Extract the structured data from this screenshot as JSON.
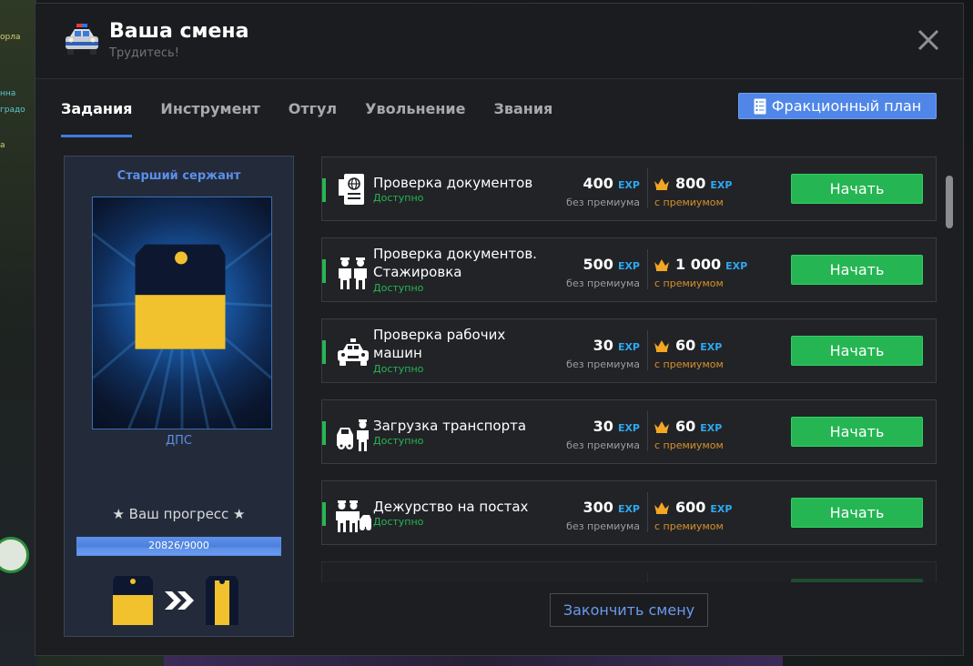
{
  "background": {
    "chat_lines": [
      "орла",
      "нна",
      "градо",
      "а"
    ]
  },
  "window": {
    "title": "Ваша смена",
    "subtitle": "Трудитесь!",
    "icon": "police-car-icon",
    "close_icon": "close-icon"
  },
  "tabs": [
    {
      "label": "Задания",
      "active": true
    },
    {
      "label": "Инструмент",
      "active": false
    },
    {
      "label": "Отгул",
      "active": false
    },
    {
      "label": "Увольнение",
      "active": false
    },
    {
      "label": "Звания",
      "active": false
    }
  ],
  "plan_button": {
    "label": "Фракционный план",
    "icon": "checklist-icon"
  },
  "rank": {
    "name": "Старший сержант",
    "department": "ДПС",
    "progress_label": "★ Ваш прогресс ★",
    "progress_text": "20826/9000",
    "progress_fraction": 1.0
  },
  "colors": {
    "accent_blue": "#4f86e8",
    "start_green": "#25b653",
    "exp_blue": "#2fa8f0",
    "premium_orange": "#d6912a",
    "rank_gold": "#f2c12e"
  },
  "tasks": [
    {
      "name": "Проверка документов",
      "status": "Доступно",
      "exp": "400",
      "exp_unit": "EXP",
      "exp_sub": "без премиума",
      "premium_exp": "800",
      "premium_unit": "EXP",
      "premium_sub": "с премиумом",
      "button": "Начать",
      "icon": "passport-icon"
    },
    {
      "name": "Проверка документов. Стажировка",
      "status": "Доступно",
      "exp": "500",
      "exp_unit": "EXP",
      "exp_sub": "без премиума",
      "premium_exp": "1 000",
      "premium_unit": "EXP",
      "premium_sub": "с премиумом",
      "button": "Начать",
      "icon": "officers-icon"
    },
    {
      "name": "Проверка рабочих машин",
      "status": "Доступно",
      "exp": "30",
      "exp_unit": "EXP",
      "exp_sub": "без премиума",
      "premium_exp": "60",
      "premium_unit": "EXP",
      "premium_sub": "с премиумом",
      "button": "Начать",
      "icon": "police-car-icon"
    },
    {
      "name": "Загрузка транспорта",
      "status": "Доступно",
      "exp": "30",
      "exp_unit": "EXP",
      "exp_sub": "без премиума",
      "premium_exp": "60",
      "premium_unit": "EXP",
      "premium_sub": "с премиумом",
      "button": "Начать",
      "icon": "tow-truck-officer-icon"
    },
    {
      "name": "Дежурство на постах",
      "status": "Доступно",
      "exp": "300",
      "exp_unit": "EXP",
      "exp_sub": "без премиума",
      "premium_exp": "600",
      "premium_unit": "EXP",
      "premium_sub": "с премиумом",
      "button": "Начать",
      "icon": "patrol-post-icon"
    }
  ],
  "finish_button": "Закончить смену"
}
